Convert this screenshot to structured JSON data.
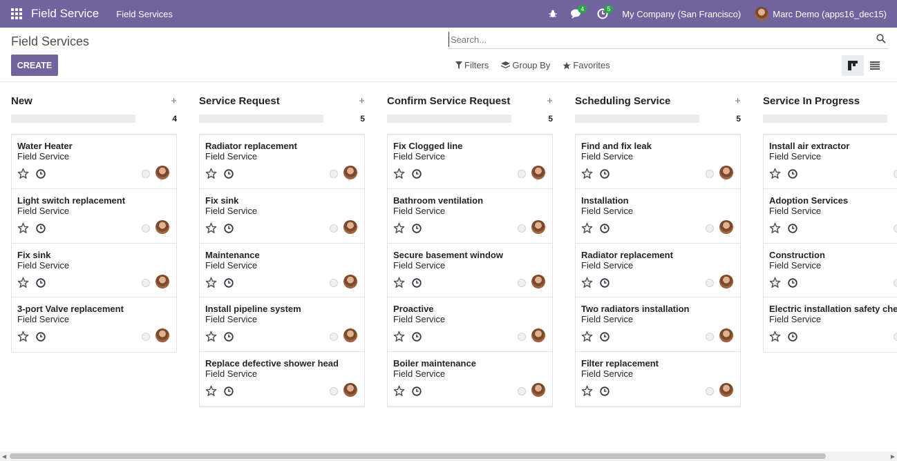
{
  "navbar": {
    "app_name": "Field Service",
    "menu": "Field Services",
    "chat_badge": "4",
    "activity_badge": "5",
    "company": "My Company (San Francisco)",
    "user": "Marc Demo (apps16_dec15)"
  },
  "control_panel": {
    "title": "Field Services",
    "create_label": "CREATE",
    "search_placeholder": "Search...",
    "filters_label": "Filters",
    "groupby_label": "Group By",
    "favorites_label": "Favorites"
  },
  "columns": [
    {
      "title": "New",
      "count": "4",
      "cards": [
        {
          "name": "Water Heater",
          "project": "Field Service"
        },
        {
          "name": "Light switch replacement",
          "project": "Field Service"
        },
        {
          "name": "Fix sink",
          "project": "Field Service"
        },
        {
          "name": "3-port Valve replacement",
          "project": "Field Service"
        }
      ]
    },
    {
      "title": "Service Request",
      "count": "5",
      "cards": [
        {
          "name": "Radiator replacement",
          "project": "Field Service"
        },
        {
          "name": "Fix sink",
          "project": "Field Service"
        },
        {
          "name": "Maintenance",
          "project": "Field Service"
        },
        {
          "name": "Install pipeline system",
          "project": "Field Service"
        },
        {
          "name": "Replace defective shower head",
          "project": "Field Service"
        }
      ]
    },
    {
      "title": "Confirm Service Request",
      "count": "5",
      "cards": [
        {
          "name": "Fix Clogged line",
          "project": "Field Service"
        },
        {
          "name": "Bathroom ventilation",
          "project": "Field Service"
        },
        {
          "name": "Secure basement window",
          "project": "Field Service"
        },
        {
          "name": "Proactive",
          "project": "Field Service"
        },
        {
          "name": "Boiler maintenance",
          "project": "Field Service"
        }
      ]
    },
    {
      "title": "Scheduling Service",
      "count": "5",
      "cards": [
        {
          "name": "Find and fix leak",
          "project": "Field Service"
        },
        {
          "name": "Installation",
          "project": "Field Service"
        },
        {
          "name": "Radiator replacement",
          "project": "Field Service"
        },
        {
          "name": "Two radiators installation",
          "project": "Field Service"
        },
        {
          "name": "Filter replacement",
          "project": "Field Service"
        }
      ]
    },
    {
      "title": "Service In Progress",
      "count": "",
      "cards": [
        {
          "name": "Install air extractor",
          "project": "Field Service"
        },
        {
          "name": "Adoption Services",
          "project": "Field Service"
        },
        {
          "name": "Construction",
          "project": "Field Service"
        },
        {
          "name": "Electric installation safety check",
          "project": "Field Service"
        }
      ]
    }
  ],
  "colors": {
    "brand": "#71639e",
    "badge": "#28a745"
  }
}
